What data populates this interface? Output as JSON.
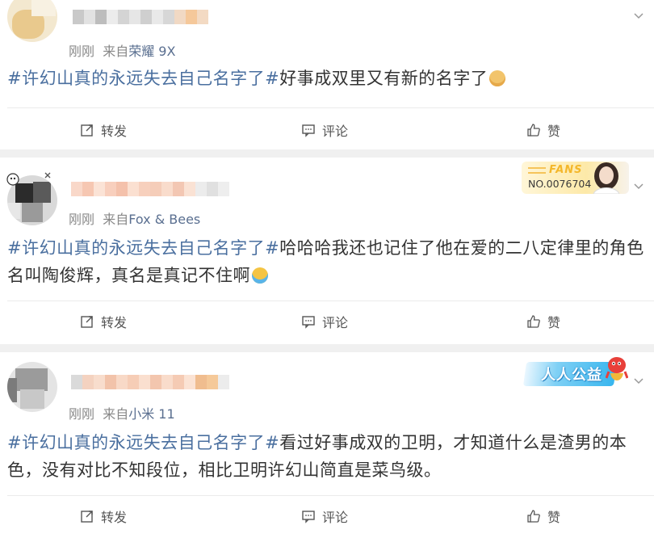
{
  "colors": {
    "topic": "#4a6f9f",
    "separator": "#f0f0f0",
    "meta": "#888888",
    "source": "#5a6f90"
  },
  "actions": {
    "repost_label": "转发",
    "comment_label": "评论",
    "like_label": "赞",
    "repost_icon": "repost-icon",
    "comment_icon": "comment-icon",
    "like_icon": "thumbs-up-icon"
  },
  "posts": [
    {
      "time": "刚刚",
      "source_prefix": "来自",
      "source": "荣耀 9X",
      "topic": "#许幻山真的永远失去自己名字了#",
      "text": "好事成双里又有新的名字了",
      "emoji": "doge-emoji"
    },
    {
      "time": "刚刚",
      "source_prefix": "来自",
      "source": "Fox & Bees",
      "badge_word": "FANS",
      "badge_number": "NO.0076704",
      "topic": "#许幻山真的永远失去自己名字了#",
      "text": "哈哈哈我还也记住了他在爱的二八定律里的角色名叫陶俊辉，真名是真记不住啊",
      "emoji": "laugh-cry-emoji"
    },
    {
      "time": "刚刚",
      "source_prefix": "来自",
      "source": "小米 11",
      "badge_label": "人人公益",
      "topic": "#许幻山真的永远失去自己名字了#",
      "text": "看过好事成双的卫明，才知道什么是渣男的本色，没有对比不知段位，相比卫明许幻山简直是菜鸟级。"
    }
  ]
}
